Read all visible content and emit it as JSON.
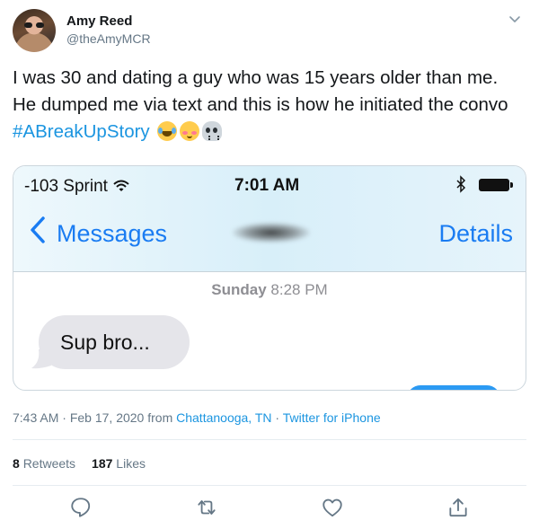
{
  "author": {
    "name": "Amy Reed",
    "handle": "@theAmyMCR",
    "avatar_icon": "user-avatar"
  },
  "tweet": {
    "text": "I was 30 and dating a guy who was 15 years older than me. He dumped me via text and this is how he initiated the convo ",
    "hashtag": "#ABreakUpStory",
    "emojis": [
      "face-with-tears-of-joy",
      "smiling-face-with-smiling-eyes",
      "skull"
    ]
  },
  "media": {
    "status_bar": {
      "carrier": "-103 Sprint",
      "time": "7:01 AM",
      "icons": [
        "wifi-icon",
        "bluetooth-icon",
        "battery-icon"
      ]
    },
    "nav": {
      "back_label": "Messages",
      "details_label": "Details"
    },
    "conversation": {
      "day": "Sunday",
      "time": "8:28 PM",
      "messages": [
        {
          "direction": "incoming",
          "text": "Sup bro..."
        }
      ]
    },
    "colors": {
      "ios_blue": "#1a7cf2",
      "bubble_gray": "#e5e5ea"
    }
  },
  "meta": {
    "time": "7:43 AM",
    "sep1": " · ",
    "date": "Feb 17, 2020",
    "from_label": " from ",
    "location": "Chattanooga, TN",
    "sep2": " · ",
    "source": "Twitter for iPhone"
  },
  "stats": {
    "retweets_count": "8",
    "retweets_label": "Retweets",
    "likes_count": "187",
    "likes_label": "Likes"
  },
  "actions": [
    "reply-icon",
    "retweet-icon",
    "like-icon",
    "share-icon"
  ],
  "colors": {
    "link_blue": "#1b95e0",
    "muted_gray": "#657786"
  }
}
